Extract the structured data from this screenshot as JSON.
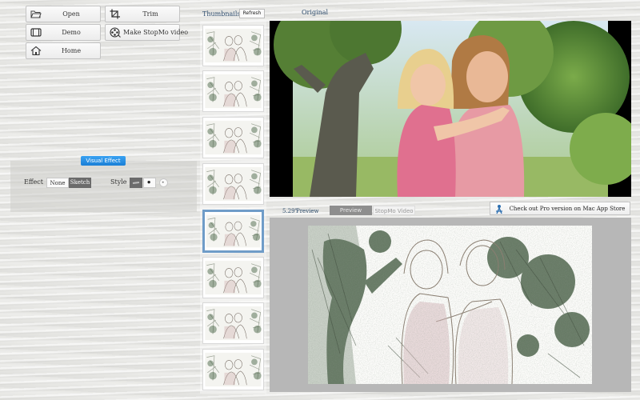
{
  "toolbar": {
    "open_label": "Open",
    "demo_label": "Demo",
    "home_label": "Home",
    "trim_label": "Trim",
    "make_video_label": "Make StopMo video",
    "icons": [
      "folder-open-icon",
      "film-icon",
      "home-icon",
      "crop-icon",
      "film-reel-icon"
    ]
  },
  "effect_panel": {
    "header": "Visual Effect",
    "effect_label": "Effect",
    "effect_options": [
      "None",
      "Sketch"
    ],
    "effect_selected": "Sketch",
    "style_label": "Style",
    "style_options": [
      "pencil",
      "dark-dot",
      "light-dot"
    ]
  },
  "thumbnails": {
    "title": "Thumbnails",
    "refresh_label": "Refresh",
    "count": 8,
    "selected_index": 4
  },
  "original": {
    "title": "Original"
  },
  "preview": {
    "time": "5.29\"",
    "title": "Preview",
    "tabs": [
      "Preview",
      "StopMo Video"
    ],
    "active_tab": "Preview",
    "pro_label": "Check out Pro version on Mac App Store",
    "pro_icon": "app-store-icon"
  },
  "colors": {
    "accent_blue": "#1a7fd6",
    "label_blue": "#2b4a6b",
    "selected_border": "#6f9cc8"
  }
}
